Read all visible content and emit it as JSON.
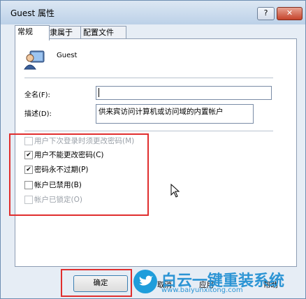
{
  "window": {
    "title": "Guest 属性"
  },
  "titlebar": {
    "help_label": "?",
    "close_label": "✕"
  },
  "tabs": [
    {
      "label": "常规"
    },
    {
      "label": "隶属于"
    },
    {
      "label": "配置文件"
    }
  ],
  "user": {
    "name": "Guest"
  },
  "fields": {
    "fullname_label": "全名(F):",
    "fullname_value": "",
    "description_label": "描述(D):",
    "description_value": "供来宾访问计算机或访问域的内置帐户"
  },
  "checkboxes": [
    {
      "label": "用户下次登录时须更改密码(M)",
      "checked": false,
      "disabled": true
    },
    {
      "label": "用户不能更改密码(C)",
      "checked": true,
      "disabled": false
    },
    {
      "label": "密码永不过期(P)",
      "checked": true,
      "disabled": false
    },
    {
      "label": "帐户已禁用(B)",
      "checked": false,
      "disabled": false
    },
    {
      "label": "帐户已锁定(O)",
      "checked": false,
      "disabled": true
    }
  ],
  "buttons": {
    "ok_label": "确定",
    "cancel_label": "取消",
    "apply_label": "应用",
    "help_label": "帮助"
  },
  "watermark": {
    "text": "白云一键重装系统",
    "sub": "www.baiyunxitong.com"
  },
  "colors": {
    "highlight": "#e02e2e",
    "watermark": "#2b94d4"
  }
}
